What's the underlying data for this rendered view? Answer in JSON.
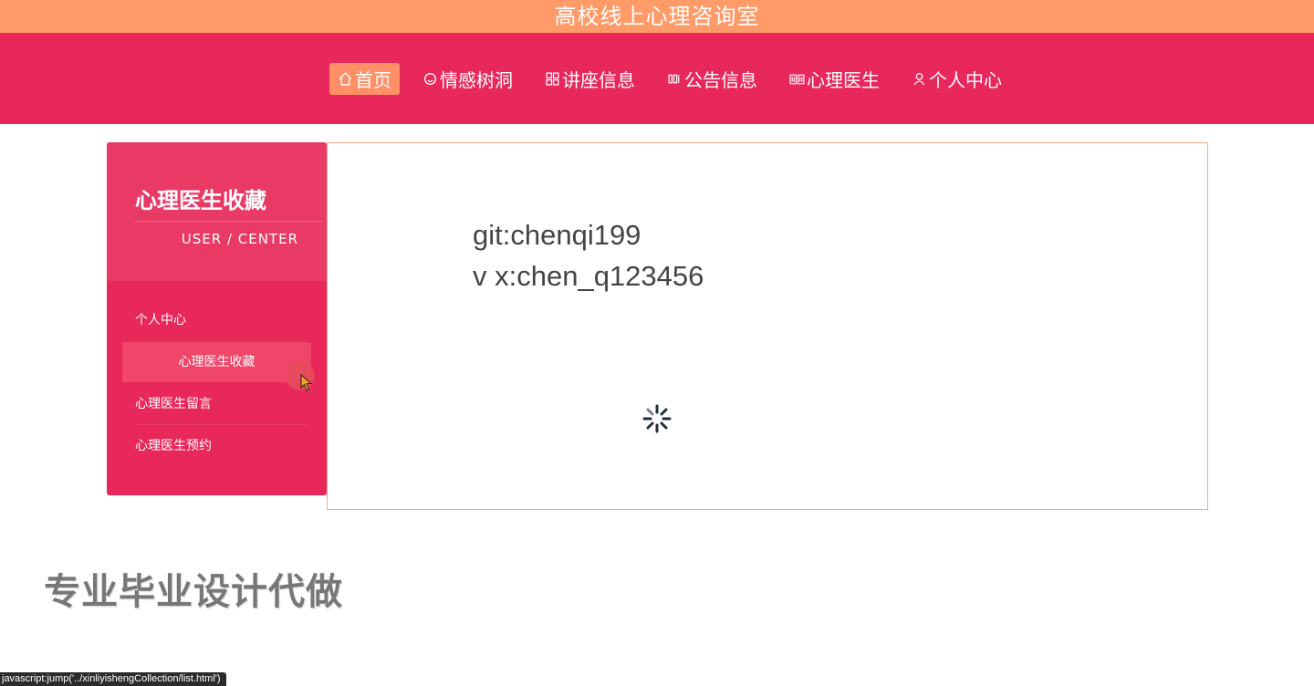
{
  "header": {
    "site_title": "高校线上心理咨询室"
  },
  "nav": {
    "items": [
      {
        "label": "首页",
        "icon": "home-icon",
        "active": true
      },
      {
        "label": "情感树洞",
        "icon": "smile-icon",
        "active": false
      },
      {
        "label": "讲座信息",
        "icon": "grid-icon",
        "active": false
      },
      {
        "label": "公告信息",
        "icon": "notice-icon",
        "active": false
      },
      {
        "label": "心理医生",
        "icon": "book-icon",
        "active": false
      },
      {
        "label": "个人中心",
        "icon": "user-icon",
        "active": false
      }
    ]
  },
  "sidebar": {
    "title": "心理医生收藏",
    "subtitle": "USER / CENTER",
    "items": [
      {
        "label": "个人中心",
        "active": false
      },
      {
        "label": "心理医生收藏",
        "active": true
      },
      {
        "label": "心理医生留言",
        "active": false
      },
      {
        "label": "心理医生预约",
        "active": false
      }
    ]
  },
  "content": {
    "line1": "git:chenqi199",
    "line2": "v x:chen_q123456"
  },
  "overlay": {
    "watermark": "专业毕业设计代做"
  },
  "statusbar": {
    "url": "javascript:jump('../xinliyishengCollection/list.html')"
  },
  "colors": {
    "top_bar": "#ff9a69",
    "nav": "#e8275a",
    "sidebar": "#e8275a",
    "accent": "#ff8f66"
  }
}
